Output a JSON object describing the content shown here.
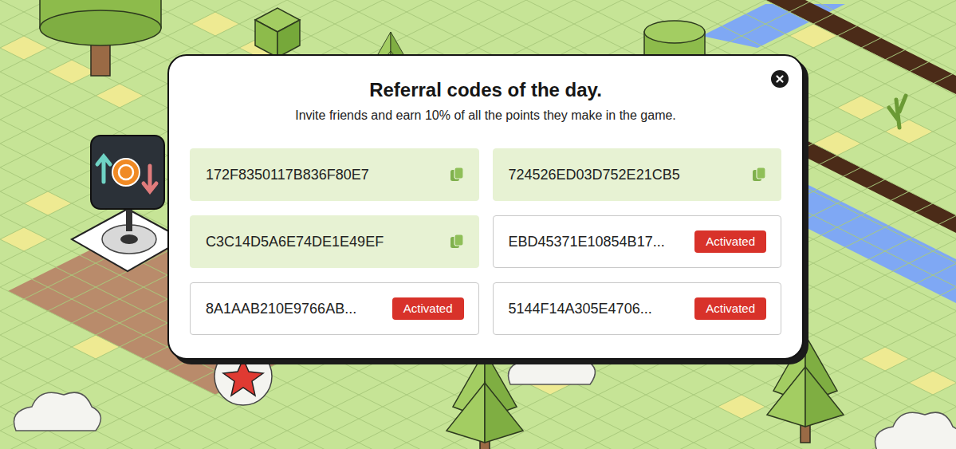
{
  "modal": {
    "title": "Referral codes of the day.",
    "subtitle": "Invite friends and earn 10% of all the points they make in the game."
  },
  "activated_label": "Activated",
  "codes": [
    {
      "code": "172F8350117B836F80E7",
      "activated": false
    },
    {
      "code": "724526ED03D752E21CB5",
      "activated": false
    },
    {
      "code": "C3C14D5A6E74DE1E49EF",
      "activated": false
    },
    {
      "code": "EBD45371E10854B17...",
      "activated": true
    },
    {
      "code": "8A1AAB210E9766AB...",
      "activated": true
    },
    {
      "code": "5144F14A305E4706...",
      "activated": true
    }
  ]
}
